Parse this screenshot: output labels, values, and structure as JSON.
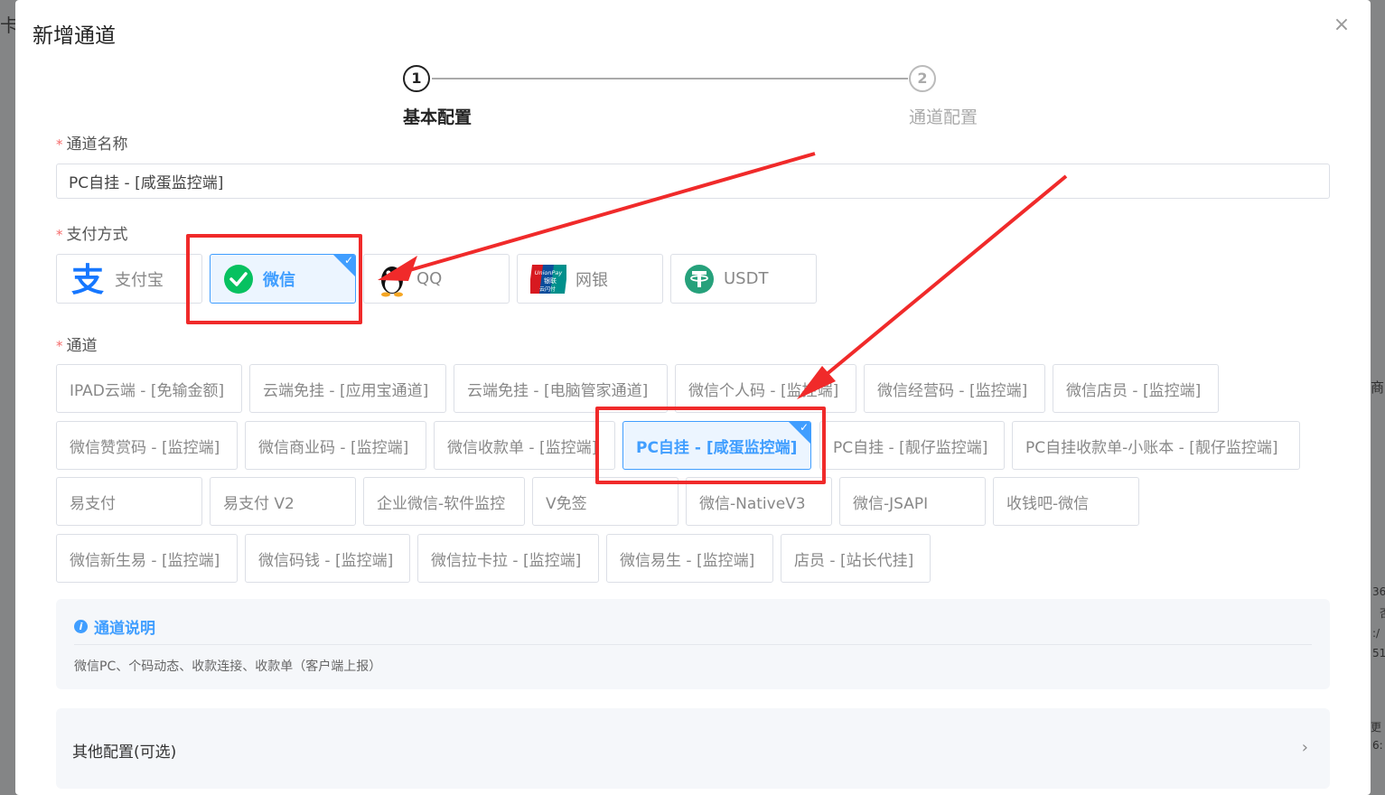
{
  "background": {
    "left_fragment": "卡",
    "right_fragments": [
      "商",
      "36",
      "否",
      ":/",
      "51",
      "更",
      "6:"
    ]
  },
  "dialog": {
    "title": "新增通道",
    "close_glyph": "×"
  },
  "steps": [
    {
      "number": "1",
      "label": "基本配置",
      "active": true
    },
    {
      "number": "2",
      "label": "通道配置",
      "active": false
    }
  ],
  "form": {
    "channel_name_label": "通道名称",
    "channel_name_value": "PC自挂 - [咸蛋监控端]",
    "required_mark": "*",
    "payment_label": "支付方式",
    "channel_label": "通道"
  },
  "payment_methods": [
    {
      "label": "支付宝",
      "icon": "alipay-icon",
      "selected": false
    },
    {
      "label": "微信",
      "icon": "wechat-icon",
      "selected": true
    },
    {
      "label": "QQ",
      "icon": "qq-penguin-icon",
      "selected": false
    },
    {
      "label": "网银",
      "icon": "unionpay-icon",
      "selected": false
    },
    {
      "label": "USDT",
      "icon": "tether-icon",
      "selected": false
    }
  ],
  "unionpay_logo_text": [
    "UnionPay",
    "银联",
    "云闪付"
  ],
  "channels": [
    {
      "label": "IPAD云端 - [免输金额]",
      "selected": false
    },
    {
      "label": "云端免挂 - [应用宝通道]",
      "selected": false
    },
    {
      "label": "云端免挂 - [电脑管家通道]",
      "selected": false
    },
    {
      "label": "微信个人码 - [监控端]",
      "selected": false
    },
    {
      "label": "微信经营码 - [监控端]",
      "selected": false
    },
    {
      "label": "微信店员 - [监控端]",
      "selected": false
    },
    {
      "label": "微信赞赏码 - [监控端]",
      "selected": false
    },
    {
      "label": "微信商业码 - [监控端]",
      "selected": false
    },
    {
      "label": "微信收款单 - [监控端]",
      "selected": false
    },
    {
      "label": "PC自挂 - [咸蛋监控端]",
      "selected": true
    },
    {
      "label": "PC自挂 - [靓仔监控端]",
      "selected": false
    },
    {
      "label": "PC自挂收款单-小账本 - [靓仔监控端]",
      "selected": false
    },
    {
      "label": "易支付",
      "selected": false
    },
    {
      "label": "易支付 V2",
      "selected": false
    },
    {
      "label": "企业微信-软件监控",
      "selected": false
    },
    {
      "label": "V免签",
      "selected": false
    },
    {
      "label": "微信-NativeV3",
      "selected": false
    },
    {
      "label": "微信-JSAPI",
      "selected": false
    },
    {
      "label": "收钱吧-微信",
      "selected": false
    },
    {
      "label": "微信新生易 - [监控端]",
      "selected": false
    },
    {
      "label": "微信码钱 - [监控端]",
      "selected": false
    },
    {
      "label": "微信拉卡拉 - [监控端]",
      "selected": false
    },
    {
      "label": "微信易生 - [监控端]",
      "selected": false
    },
    {
      "label": "店员 - [站长代挂]",
      "selected": false
    }
  ],
  "description": {
    "title": "通道说明",
    "info_glyph": "i",
    "text": "微信PC、个码动态、收款连接、收款单（客户端上报）"
  },
  "other_config": {
    "label": "其他配置(可选)",
    "chevron": "›"
  },
  "check_glyph": "✓",
  "colors": {
    "primary": "#409eff",
    "annotation_red": "#f02a2a",
    "required_red": "#f56c6c",
    "wechat_green": "#07c160",
    "alipay_blue": "#1677ff",
    "tether_green": "#26a17b"
  }
}
